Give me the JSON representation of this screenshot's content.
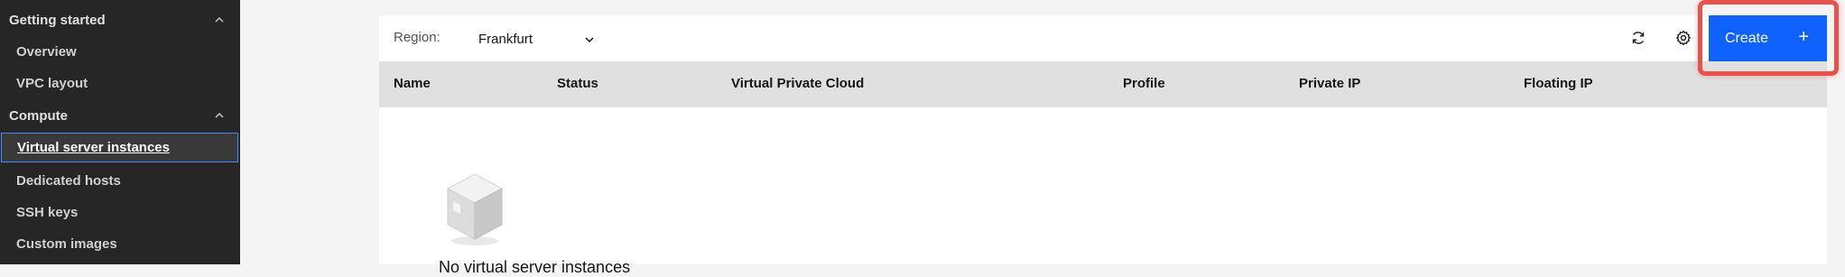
{
  "sidebar": {
    "groups": [
      {
        "label": "Getting started",
        "items": [
          {
            "label": "Overview"
          },
          {
            "label": "VPC layout"
          }
        ]
      },
      {
        "label": "Compute",
        "items": [
          {
            "label": "Virtual server instances"
          },
          {
            "label": "Dedicated hosts"
          },
          {
            "label": "SSH keys"
          },
          {
            "label": "Custom images"
          }
        ]
      }
    ]
  },
  "toolbar": {
    "region_label": "Region:",
    "region_value": "Frankfurt",
    "create_label": "Create",
    "create_icon": "+"
  },
  "table": {
    "columns": [
      "Name",
      "Status",
      "Virtual Private Cloud",
      "Profile",
      "Private IP",
      "Floating IP"
    ]
  },
  "empty_state": {
    "message": "No virtual server instances"
  },
  "colors": {
    "sidebar_bg": "#262626",
    "primary": "#0f62fe",
    "highlight": "#e8524a",
    "active_border": "#4589ff"
  }
}
